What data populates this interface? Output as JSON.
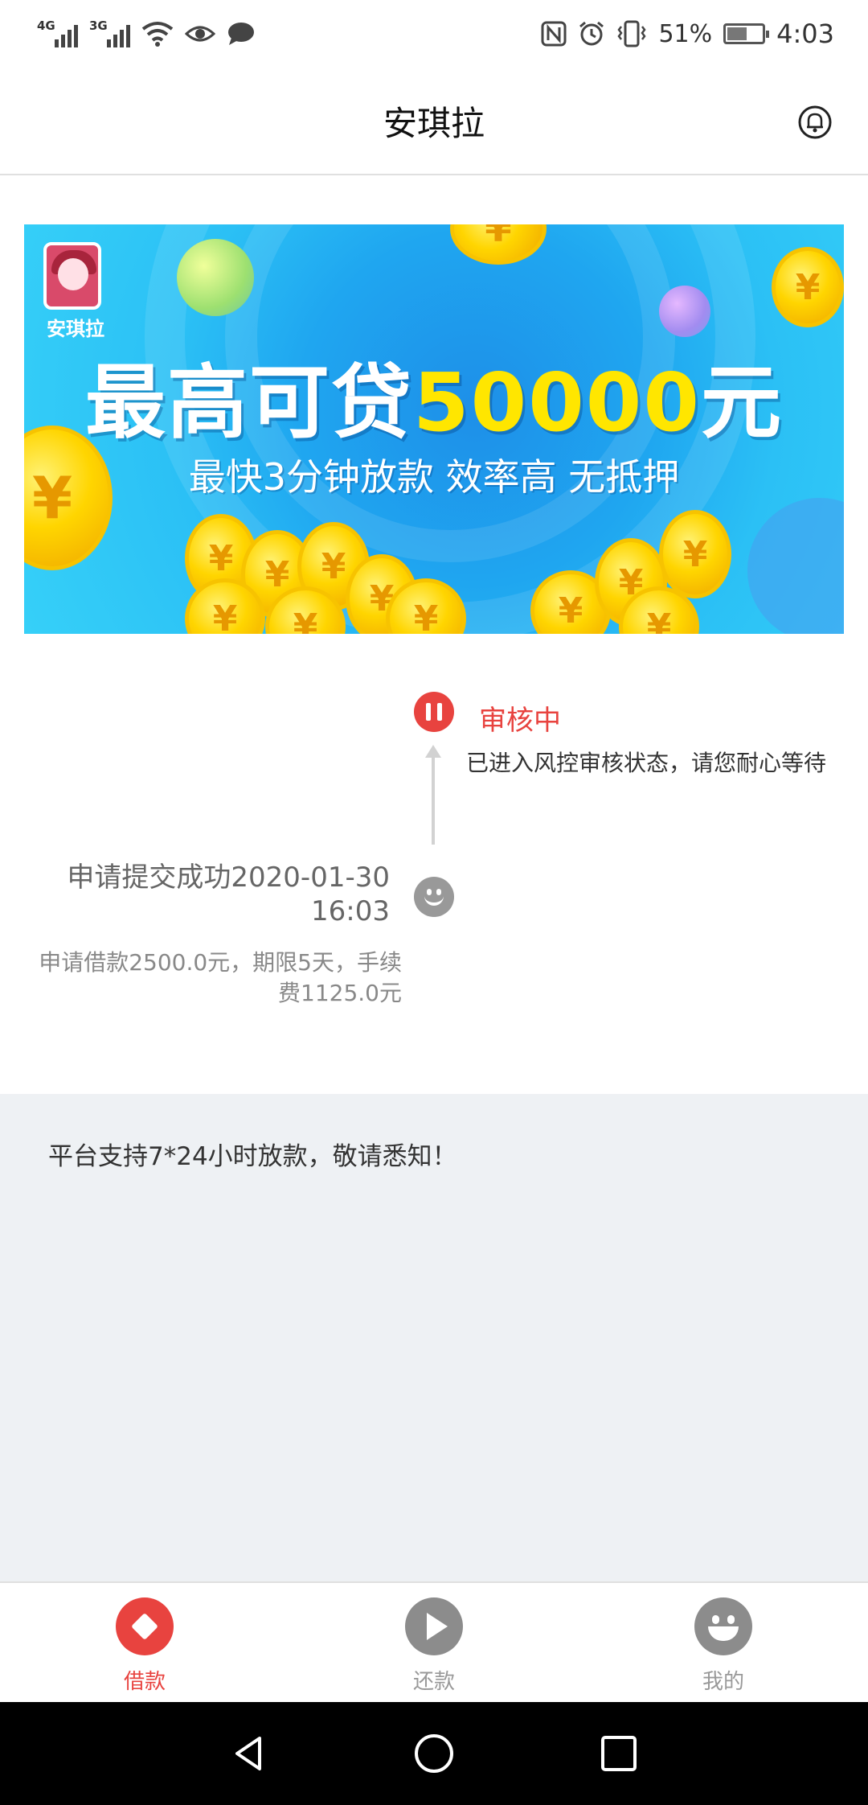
{
  "status_bar": {
    "network_1": "4G",
    "network_2": "3G",
    "battery_percent": "51%",
    "battery_level": 0.51,
    "time": "4:03",
    "icons": [
      "signal-icon",
      "wifi-icon",
      "eye-icon",
      "message-icon",
      "nfc-icon",
      "alarm-icon",
      "vibrate-icon",
      "battery-icon"
    ]
  },
  "header": {
    "title": "安琪拉",
    "bell_icon": "bell-icon"
  },
  "banner": {
    "logo_text": "安琪拉",
    "headline_prefix": "最高可贷",
    "headline_amount": "50000",
    "headline_suffix": "元",
    "subline": "最快3分钟放款 效率高 无抵押",
    "colors": {
      "background": "#1fa6f0",
      "highlight": "#ffe600",
      "coin": "#ffd500"
    }
  },
  "timeline": {
    "current": {
      "title": "审核中",
      "description": "已进入风控审核状态，请您耐心等待",
      "icon": "pause-icon",
      "color": "#e8433f"
    },
    "previous": {
      "title": "申请提交成功2020-01-30 16:03",
      "description": "申请借款2500.0元，期限5天，手续费1125.0元",
      "icon": "smile-icon"
    }
  },
  "notice": {
    "text": "平台支持7*24小时放款，敬请悉知！"
  },
  "tabs": [
    {
      "label": "借款",
      "icon": "diamond-icon",
      "active": true
    },
    {
      "label": "还款",
      "icon": "play-icon",
      "active": false
    },
    {
      "label": "我的",
      "icon": "smile-icon",
      "active": false
    }
  ],
  "accent_color": "#e8433f"
}
